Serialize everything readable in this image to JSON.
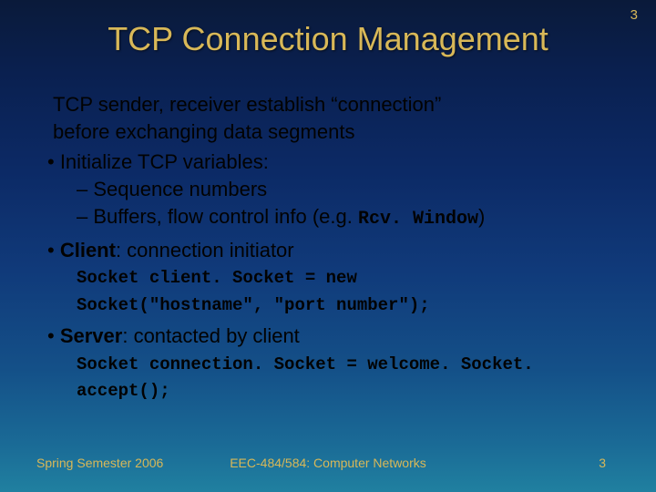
{
  "page_number_top": "3",
  "title": "TCP Connection Management",
  "intro_line1": "TCP sender, receiver establish “connection”",
  "intro_line2": "before exchanging data segments",
  "b1": "•  Initialize TCP variables:",
  "d1": "– Sequence numbers",
  "d2_pre": "– Buffers, flow control info (e.g. ",
  "d2_mono": "Rcv. Window",
  "d2_post": ")",
  "b2_pre": "•  ",
  "b2_bold": "Client",
  "b2_post": ": connection initiator",
  "code1_l1": "Socket client. Socket = new",
  "code1_l2": "Socket(\"hostname\", \"port number\");",
  "b3_pre": "•  ",
  "b3_bold": "Server",
  "b3_post": ": contacted by client",
  "code2_l1": "Socket connection. Socket = welcome. Socket. accept();",
  "footer_left": "Spring Semester 2006",
  "footer_center": "EEC-484/584: Computer Networks",
  "footer_right": "3"
}
